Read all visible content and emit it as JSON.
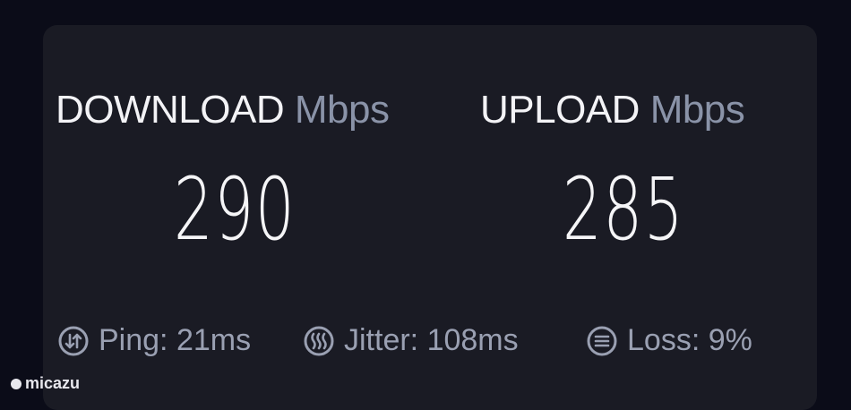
{
  "download": {
    "label": "DOWNLOAD",
    "unit": "Mbps",
    "value": "290"
  },
  "upload": {
    "label": "UPLOAD",
    "unit": "Mbps",
    "value": "285"
  },
  "stats": {
    "ping": {
      "icon": "ping-icon",
      "text": "Ping: 21ms"
    },
    "jitter": {
      "icon": "jitter-icon",
      "text": "Jitter: 108ms"
    },
    "loss": {
      "icon": "loss-icon",
      "text": "Loss: 9%"
    }
  },
  "watermark": {
    "text": "micazu"
  },
  "colors": {
    "background": "#0b0c18",
    "card": "#1a1b24",
    "primary_text": "#f3f3f6",
    "secondary_text": "#8a93a8"
  }
}
